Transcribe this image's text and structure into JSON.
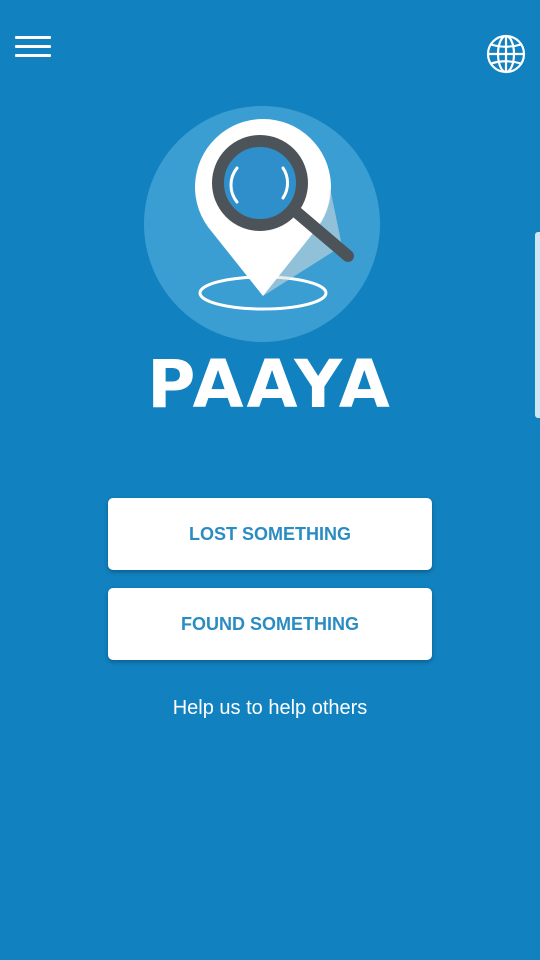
{
  "header": {
    "menu_icon": "hamburger-menu-icon",
    "language_icon": "globe-icon"
  },
  "logo": {
    "icon": "location-pin-magnifier-icon",
    "title": "PAAYA"
  },
  "actions": {
    "lost_label": "LOST SOMETHING",
    "found_label": "FOUND SOMETHING"
  },
  "tagline": "Help us to help others",
  "colors": {
    "background": "#1181bf",
    "logo_circle": "#3a9ed3",
    "button_text": "#2a8cc2",
    "button_bg": "#ffffff",
    "magnifier_frame": "#4d5459"
  }
}
